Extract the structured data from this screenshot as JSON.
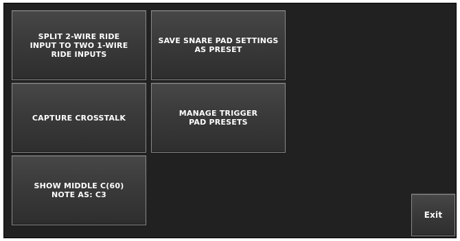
{
  "buttons": {
    "split_ride": "SPLIT 2-WIRE RIDE\nINPUT TO TWO 1-WIRE\nRIDE INPUTS",
    "save_snare": "SAVE SNARE PAD SETTINGS\nAS PRESET",
    "capture_crosstalk": "CAPTURE CROSSTALK",
    "manage_presets": "MANAGE TRIGGER\nPAD PRESETS",
    "show_middle_c": "SHOW MIDDLE C(60)\nNOTE AS: C3",
    "exit": "Exit"
  }
}
